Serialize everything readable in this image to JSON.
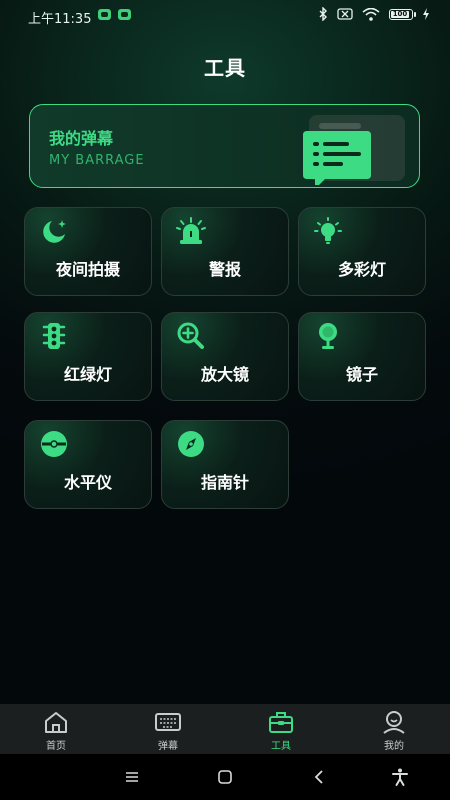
{
  "status_bar": {
    "time": "上午11:35",
    "battery": "100"
  },
  "header": {
    "title": "工具"
  },
  "barrage_card": {
    "title": "我的弹幕",
    "subtitle": "MY BARRAGE"
  },
  "tools": [
    {
      "label": "夜间拍摄",
      "icon": "moon-icon"
    },
    {
      "label": "警报",
      "icon": "alarm-icon"
    },
    {
      "label": "多彩灯",
      "icon": "bulb-icon"
    },
    {
      "label": "红绿灯",
      "icon": "traffic-light-icon"
    },
    {
      "label": "放大镜",
      "icon": "magnifier-icon"
    },
    {
      "label": "镜子",
      "icon": "mirror-icon"
    },
    {
      "label": "水平仪",
      "icon": "level-icon"
    },
    {
      "label": "指南针",
      "icon": "compass-icon"
    }
  ],
  "bottom_nav": [
    {
      "label": "首页",
      "icon": "home-icon"
    },
    {
      "label": "弹幕",
      "icon": "keyboard-icon"
    },
    {
      "label": "工具",
      "icon": "toolbox-icon",
      "active": true
    },
    {
      "label": "我的",
      "icon": "profile-icon"
    }
  ],
  "colors": {
    "accent": "#3ddc84",
    "background": "#03080b"
  }
}
